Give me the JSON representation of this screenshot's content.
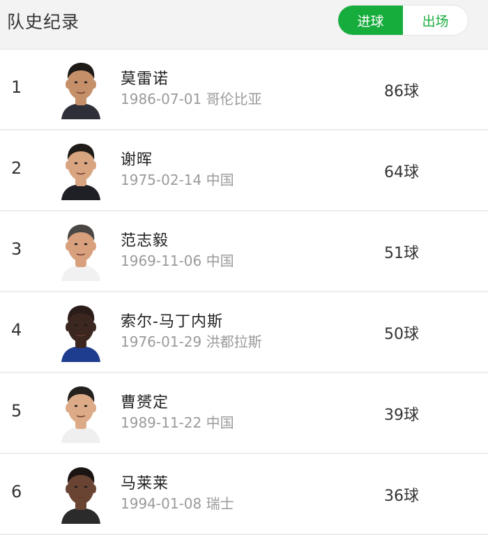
{
  "header": {
    "title": "队史纪录",
    "tabs": [
      {
        "label": "进球",
        "active": true
      },
      {
        "label": "出场",
        "active": false
      }
    ]
  },
  "colors": {
    "accent": "#16ad3d"
  },
  "players": [
    {
      "rank": "1",
      "name": "莫雷诺",
      "birth": "1986-07-01",
      "country": "哥伦比亚",
      "goals": "86球",
      "skin": "#c58f6a",
      "hair": "#1e1a18",
      "shirt": "#2f2f3a"
    },
    {
      "rank": "2",
      "name": "谢晖",
      "birth": "1975-02-14",
      "country": "中国",
      "goals": "64球",
      "skin": "#d9a480",
      "hair": "#1f1b18",
      "shirt": "#1f1f26"
    },
    {
      "rank": "3",
      "name": "范志毅",
      "birth": "1969-11-06",
      "country": "中国",
      "goals": "51球",
      "skin": "#d8a07c",
      "hair": "#4a4644",
      "shirt": "#f1f1f1"
    },
    {
      "rank": "4",
      "name": "索尔-马丁内斯",
      "birth": "1976-01-29",
      "country": "洪都拉斯",
      "goals": "50球",
      "skin": "#3b2620",
      "hair": "#2a1c18",
      "shirt": "#1e3d8e"
    },
    {
      "rank": "5",
      "name": "曹赟定",
      "birth": "1989-11-22",
      "country": "中国",
      "goals": "39球",
      "skin": "#dcaa86",
      "hair": "#23201d",
      "shirt": "#efefef"
    },
    {
      "rank": "6",
      "name": "马莱莱",
      "birth": "1994-01-08",
      "country": "瑞士",
      "goals": "36球",
      "skin": "#6a4433",
      "hair": "#1a1412",
      "shirt": "#2b2b2b"
    }
  ]
}
